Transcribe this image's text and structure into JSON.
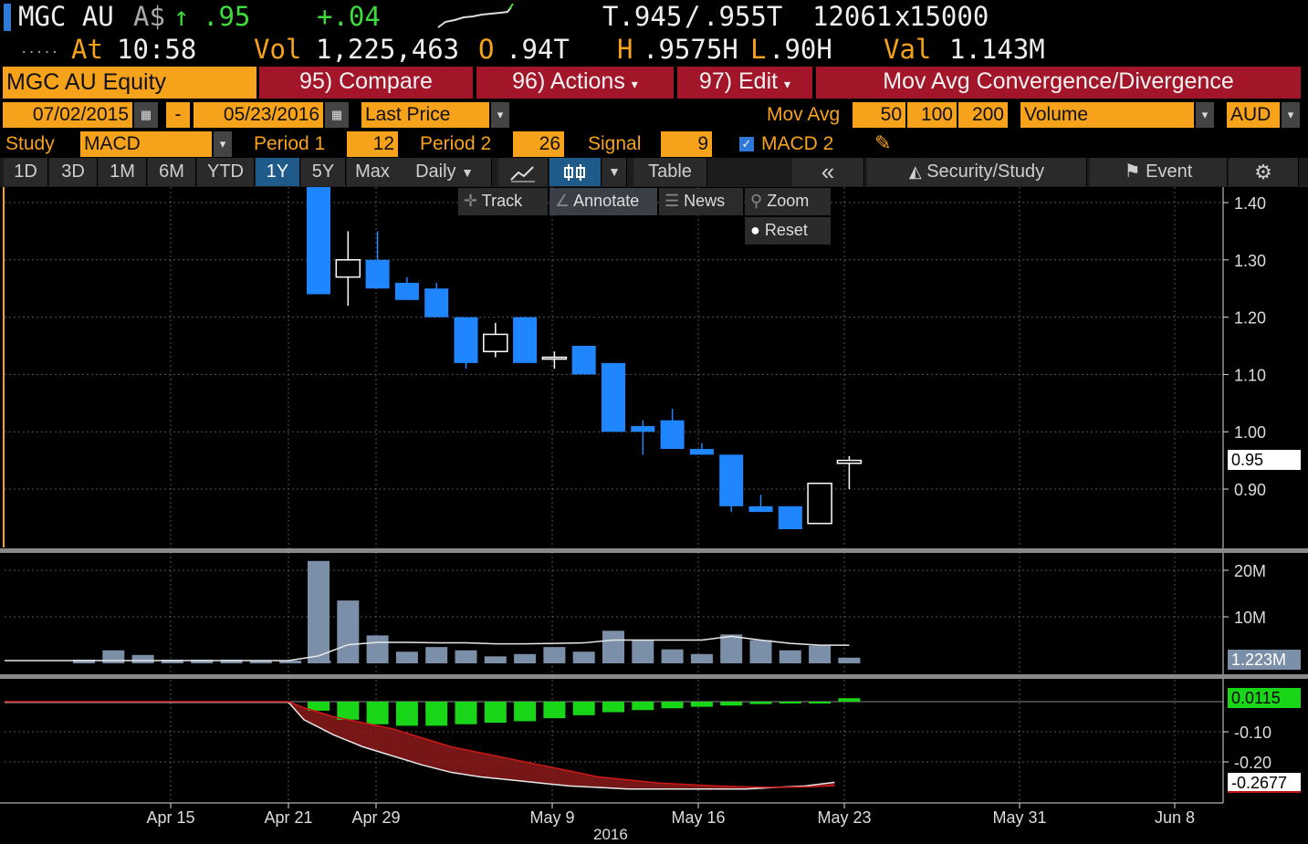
{
  "quote": {
    "ticker": "MGC AU",
    "currency": "A$",
    "arrow": "↑",
    "last": ".95",
    "change": "+.04",
    "bid": "T.945",
    "sep": "/",
    "ask": ".955T",
    "size_bid": "12061",
    "size_x": "x",
    "size_ask": "15000",
    "dots": ".....",
    "at_label": "At",
    "time": "10:58",
    "vol_label": "Vol",
    "volume": "1,225,463",
    "open_label": "O",
    "open": ".94T",
    "high_label": "H",
    "high": ".9575H",
    "low_label": "L",
    "low": ".90H",
    "val_label": "Val",
    "value": "1.143M"
  },
  "toolbar": {
    "security": "MGC AU Equity",
    "compare": "95) Compare",
    "actions": "96) Actions",
    "edit": "97) Edit",
    "study_title": "Mov Avg Convergence/Divergence"
  },
  "range": {
    "start": "07/02/2015",
    "dash": "-",
    "end": "05/23/2016",
    "price_field": "Last Price",
    "mov_avg_label": "Mov Avg",
    "ma1": "50",
    "ma2": "100",
    "ma3": "200",
    "lower_field": "Volume",
    "currency": "AUD"
  },
  "study": {
    "label": "Study",
    "name": "MACD",
    "period1_label": "Period 1",
    "period1": "12",
    "period2_label": "Period 2",
    "period2": "26",
    "signal_label": "Signal",
    "signal": "9",
    "macd2_label": "MACD 2"
  },
  "tabs": {
    "periods": [
      "1D",
      "3D",
      "1M",
      "6M",
      "YTD",
      "1Y",
      "5Y",
      "Max"
    ],
    "active_period": "1Y",
    "frequency": "Daily",
    "table": "Table",
    "collapse": "«",
    "security_study": "Security/Study",
    "event": "Event"
  },
  "popup": {
    "track": "Track",
    "annotate": "Annotate",
    "news": "News",
    "zoom": "Zoom",
    "reset": "Reset"
  },
  "colors": {
    "up_candle": "#ffffff",
    "down_candle": "#1f86ff",
    "volume_bar": "#7c8fa8",
    "macd_hist": "#19d619",
    "macd_fill": "#8c1a1a",
    "accent_orange": "#f7a21b",
    "toolbar_red": "#a3162a"
  },
  "chart_data": {
    "type": "candlestick",
    "price_axis": {
      "ticks": [
        "1.40",
        "1.30",
        "1.20",
        "1.10",
        "1.00",
        "0.90"
      ],
      "last_tag": "0.95",
      "range": [
        0.795,
        1.43
      ]
    },
    "volume_axis": {
      "ticks": [
        "20M",
        "10M"
      ],
      "last_tag": "1.223M",
      "range": [
        0,
        23
      ]
    },
    "macd_axis": {
      "ticks": [
        "-0.10",
        "-0.20"
      ],
      "hist_tag": "0.0115",
      "macd_tag": "-0.2677",
      "range": [
        -0.3,
        0.02
      ]
    },
    "x_labels": [
      "Apr 15",
      "Apr 21",
      "Apr 29",
      "May 9",
      "May 16",
      "May 23",
      "May 31",
      "Jun 8"
    ],
    "year_label": "2016",
    "candles": [
      {
        "o": 1.43,
        "h": 1.43,
        "l": 1.24,
        "c": 1.24
      },
      {
        "o": 1.27,
        "h": 1.35,
        "l": 1.22,
        "c": 1.3
      },
      {
        "o": 1.3,
        "h": 1.35,
        "l": 1.25,
        "c": 1.25
      },
      {
        "o": 1.26,
        "h": 1.27,
        "l": 1.23,
        "c": 1.23
      },
      {
        "o": 1.25,
        "h": 1.26,
        "l": 1.2,
        "c": 1.2
      },
      {
        "o": 1.2,
        "h": 1.2,
        "l": 1.11,
        "c": 1.12
      },
      {
        "o": 1.14,
        "h": 1.19,
        "l": 1.13,
        "c": 1.17
      },
      {
        "o": 1.2,
        "h": 1.2,
        "l": 1.12,
        "c": 1.12
      },
      {
        "o": 1.13,
        "h": 1.14,
        "l": 1.11,
        "c": 1.13
      },
      {
        "o": 1.15,
        "h": 1.15,
        "l": 1.1,
        "c": 1.1
      },
      {
        "o": 1.12,
        "h": 1.12,
        "l": 1.0,
        "c": 1.0
      },
      {
        "o": 1.01,
        "h": 1.02,
        "l": 0.96,
        "c": 1.0
      },
      {
        "o": 1.02,
        "h": 1.04,
        "l": 0.97,
        "c": 0.97
      },
      {
        "o": 0.97,
        "h": 0.98,
        "l": 0.96,
        "c": 0.96
      },
      {
        "o": 0.96,
        "h": 0.96,
        "l": 0.86,
        "c": 0.87
      },
      {
        "o": 0.87,
        "h": 0.89,
        "l": 0.86,
        "c": 0.86
      },
      {
        "o": 0.87,
        "h": 0.87,
        "l": 0.83,
        "c": 0.83
      },
      {
        "o": 0.84,
        "h": 0.91,
        "l": 0.84,
        "c": 0.91
      },
      {
        "o": 0.945,
        "h": 0.9575,
        "l": 0.9,
        "c": 0.95
      }
    ],
    "volume": [
      22,
      13.5,
      6,
      2.5,
      3.5,
      2.8,
      1.5,
      2,
      3.5,
      2.5,
      7,
      5,
      3,
      2,
      6.2,
      5,
      2.8,
      3.8,
      1.223
    ],
    "volume_ma": [
      1.6,
      4,
      4.5,
      4.5,
      4.4,
      4.4,
      4.2,
      4.2,
      4.3,
      4.4,
      5,
      5,
      5,
      5,
      5.8,
      5,
      4.3,
      3.9,
      3.9
    ],
    "pre_volume": [
      0.8,
      2.8,
      1.8,
      0.8,
      0.8,
      0.8,
      0.7,
      0.6,
      0.6
    ],
    "macd_hist": [
      -0.03,
      -0.06,
      -0.075,
      -0.08,
      -0.08,
      -0.075,
      -0.07,
      -0.065,
      -0.055,
      -0.045,
      -0.035,
      -0.028,
      -0.022,
      -0.017,
      -0.013,
      -0.008,
      -0.004,
      0.0,
      0.0115
    ],
    "macd_line": [
      -0.06,
      -0.11,
      -0.15,
      -0.18,
      -0.21,
      -0.235,
      -0.25,
      -0.26,
      -0.27,
      -0.28,
      -0.285,
      -0.29,
      -0.29,
      -0.29,
      -0.29,
      -0.29,
      -0.285,
      -0.28,
      -0.2677
    ],
    "signal_line": [
      -0.02,
      -0.05,
      -0.07,
      -0.09,
      -0.12,
      -0.15,
      -0.17,
      -0.19,
      -0.21,
      -0.23,
      -0.25,
      -0.26,
      -0.27,
      -0.275,
      -0.28,
      -0.283,
      -0.285,
      -0.283,
      -0.279
    ]
  }
}
